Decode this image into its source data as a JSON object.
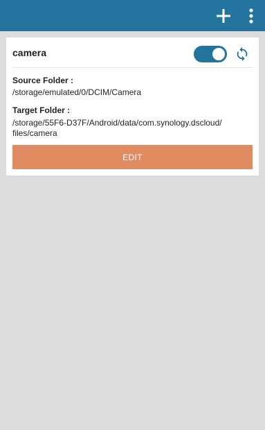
{
  "appbar": {
    "actions": [
      {
        "name": "add",
        "icon": "plus-icon"
      },
      {
        "name": "more",
        "icon": "more-vert-icon"
      }
    ]
  },
  "task": {
    "name": "camera",
    "enabled": true,
    "sync_icon": "sync-icon",
    "source_label": "Source Folder :",
    "source_path": "/storage/emulated/0/DCIM/Camera",
    "target_label": "Target Folder :",
    "target_path_line1": "/storage/55F6-D37F/Android/data/com.synology.dscloud/",
    "target_path_line2": "files/camera",
    "edit_label": "EDIT"
  },
  "colors": {
    "appbar": "#22739e",
    "accent": "#22739e",
    "edit_button": "#e08b62",
    "background": "#dcdcdc"
  }
}
